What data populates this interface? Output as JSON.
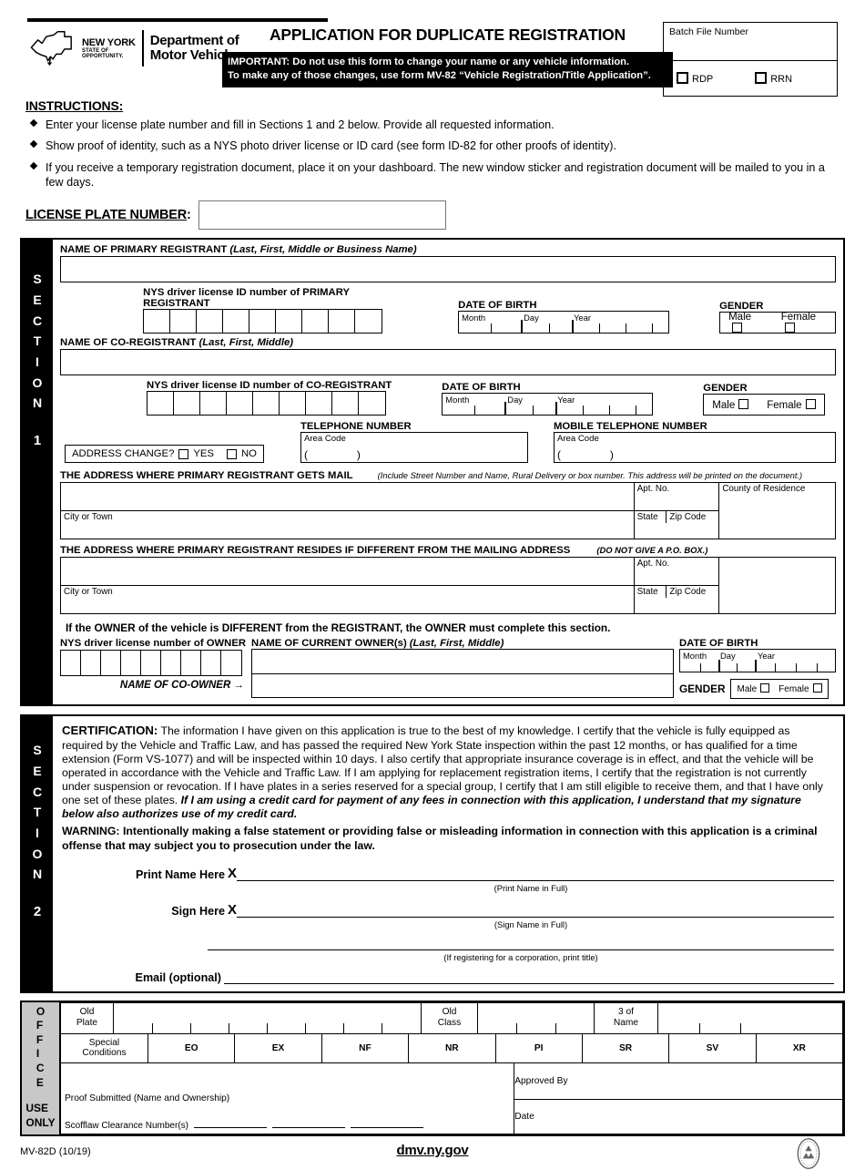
{
  "header": {
    "agency_line1": "NEW YORK",
    "agency_line2": "STATE OF",
    "agency_line3": "OPPORTUNITY.",
    "department_line1": "Department of",
    "department_line2": "Motor Vehicles",
    "title": "APPLICATION FOR DUPLICATE REGISTRATION",
    "important_line1": "IMPORTANT: Do not use this form to change your name or any vehicle information.",
    "important_line2": "To make any of those changes, use form MV-82 “Vehicle Registration/Title Application”.",
    "batch_file_label": "Batch File Number",
    "rdp_label": "RDP",
    "rrn_label": "RRN"
  },
  "instructions": {
    "title": "INSTRUCTIONS:",
    "items": [
      "Enter your license plate number and fill in Sections 1 and 2 below. Provide all requested information.",
      "Show proof of identity, such as a NYS photo driver license or ID card (see form ID-82 for other proofs of identity).",
      "If you receive a temporary registration document, place it on your dashboard. The new window sticker and registration document will be mailed to you in a few days."
    ]
  },
  "license_plate": {
    "label": "LICENSE PLATE NUMBER",
    "colon": ":",
    "value": ""
  },
  "section1": {
    "bar_letters": [
      "S",
      "E",
      "C",
      "T",
      "I",
      "O",
      "N"
    ],
    "bar_number": "1",
    "primary_name_label": "NAME OF PRIMARY REGISTRANT",
    "primary_name_hint": "(Last, First, Middle or Business Name)",
    "primary_name_value": "",
    "primary_license_label": "NYS driver license ID number of PRIMARY REGISTRANT",
    "coreg_name_label": "NAME OF CO-REGISTRANT",
    "coreg_name_hint": "(Last, First, Middle)",
    "coreg_name_value": "",
    "coreg_license_label": "NYS driver license ID number of CO-REGISTRANT",
    "dob_label": "DATE OF BIRTH",
    "dob_month": "Month",
    "dob_day": "Day",
    "dob_year": "Year",
    "gender_label": "GENDER",
    "gender_male": "Male",
    "gender_female": "Female",
    "address_change_label": "ADDRESS  CHANGE?",
    "address_change_yes": "YES",
    "address_change_no": "NO",
    "telephone_label": "TELEPHONE NUMBER",
    "mobile_telephone_label": "MOBILE TELEPHONE NUMBER",
    "area_code_label": "Area Code",
    "paren_open": "(",
    "paren_close": ")",
    "mail_address_label": "THE ADDRESS WHERE PRIMARY REGISTRANT GETS MAIL",
    "mail_address_hint": "(Include Street Number and Name, Rural Delivery or box number. This address will be printed on the document.)",
    "apt_no_label": "Apt. No.",
    "county_label": "County of Residence",
    "city_label": "City or Town",
    "state_label": "State",
    "zip_label": "Zip Code",
    "residence_address_label": "THE ADDRESS WHERE PRIMARY REGISTRANT RESIDES IF DIFFERENT FROM THE MAILING ADDRESS",
    "residence_address_hint": "(DO NOT GIVE A P.O. BOX.)",
    "owner_notice": "If the OWNER of the vehicle is DIFFERENT from the REGISTRANT, the OWNER must complete this section.",
    "owner_license_label": "NYS driver license number of OWNER",
    "owner_name_label": "NAME OF CURRENT OWNER(s)",
    "owner_name_hint": "(Last, First, Middle)",
    "coowner_label": "NAME OF CO-OWNER",
    "coowner_arrow": "→"
  },
  "section2": {
    "bar_letters": [
      "S",
      "E",
      "C",
      "T",
      "I",
      "O",
      "N"
    ],
    "bar_number": "2",
    "certification_heading": "CERTIFICATION:",
    "certification_body": " The information I have given on this application is true to the best of my knowledge. I certify that the vehicle is fully equipped as required by the Vehicle and Traffic Law, and has passed the required New York State inspection within the past 12 months, or has qualified for a time extension (Form VS-1077) and will be inspected within 10 days. I also certify that appropriate insurance coverage is in effect, and that the vehicle will be operated in accordance with the Vehicle and Traffic Law. If I am applying for replacement registration items, I certify that the registration is not currently under suspension or revocation. If I have plates in a series reserved for a special group, I certify that I am still eligible to receive them, and that I have only one set of these plates. ",
    "certification_credit": "If I am using a credit card for payment of any fees in connection with this application, I understand that my signature below also authorizes use of my credit card.",
    "warning_heading": "WARNING:",
    "warning_body": "  Intentionally making a false statement or providing false or misleading information in connection with this application is a criminal offense that may subject you to prosecution under the law.",
    "print_name_label": "Print Name Here",
    "print_name_x": "X",
    "print_name_caption": "(Print Name in Full)",
    "sign_here_label": "Sign Here",
    "sign_here_x": "X",
    "sign_caption": "(Sign Name in Full)",
    "title_caption": "(If registering for a corporation, print title)",
    "email_label": "Email (optional)"
  },
  "office_use": {
    "bar_letters": [
      "O",
      "F",
      "F",
      "I",
      "C",
      "E"
    ],
    "bar_line1": "USE",
    "bar_line2": "ONLY",
    "old_plate_l1": "Old",
    "old_plate_l2": "Plate",
    "old_class_l1": "Old",
    "old_class_l2": "Class",
    "name_l1": "3  of",
    "name_l2": "Name",
    "special_conditions_l1": "Special",
    "special_conditions_l2": "Conditions",
    "condition_codes": [
      "EO",
      "EX",
      "NF",
      "NR",
      "PI",
      "SR",
      "SV",
      "XR"
    ],
    "proof_submitted_label": "Proof Submitted  (Name and Ownership)",
    "scofflaw_label": "Scofflaw Clearance Number(s)",
    "approved_by_label": "Approved By",
    "date_label": "Date"
  },
  "footer": {
    "form_number": "MV-82D (10/19)",
    "url": "dmv.ny.gov"
  }
}
